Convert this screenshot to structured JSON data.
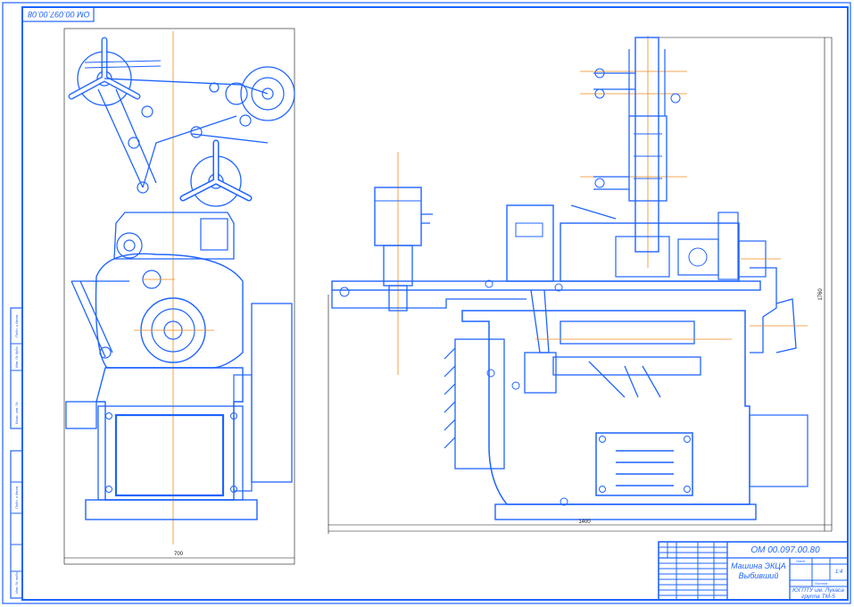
{
  "sheet": {
    "corner_code": "ОМ 00.097.00.08",
    "dim_width_left": "700",
    "dim_width_right": "1400",
    "dim_height_right": "1760",
    "side_strip_labels": [
      "Подп. и дата",
      "Инв. № дубл.",
      "Взам. инв. №",
      "Подп. и дата",
      "Инв. № подл."
    ]
  },
  "title_block": {
    "designation": "ОМ 00.097.00.80",
    "name_line1": "Машина ЭКЦА",
    "name_line2": "Выбивший",
    "scale": "1:4",
    "org_line1": "ЮГПТУ им. Лукаса",
    "org_line2": "группа ТМ-5",
    "sheet_label": "Лист",
    "sheets_label": "Листов"
  }
}
